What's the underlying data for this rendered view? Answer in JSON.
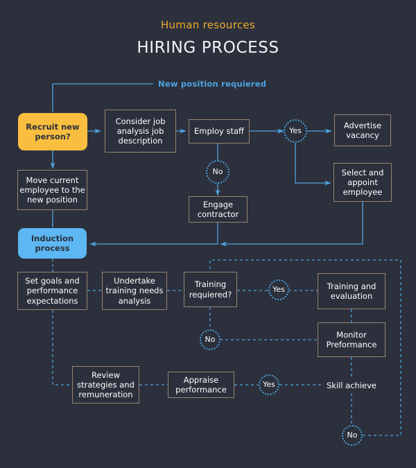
{
  "header": {
    "subtitle": "Human resources",
    "title": "HIRING PROCESS"
  },
  "colors": {
    "background": "#2b303c",
    "accent_yellow": "#f9be3f",
    "accent_blue": "#5db7f2",
    "line_blue": "#4fa3e0",
    "box_border": "#9b8470",
    "text": "#ffffff",
    "subtitle": "#f0ab2a"
  },
  "edge_labels": [
    {
      "id": "new-position",
      "text": "New position requiered"
    }
  ],
  "nodes": [
    {
      "id": "recruit-new-person",
      "label": "Recruit new person?",
      "shape": "rounded-yellow"
    },
    {
      "id": "consider-job-analysis",
      "label": "Consider job analysis job description",
      "shape": "rect"
    },
    {
      "id": "employ-staff",
      "label": "Employ staff",
      "shape": "rect"
    },
    {
      "id": "decision-yes-employ",
      "label": "Yes",
      "shape": "circle"
    },
    {
      "id": "advertise-vacancy",
      "label": "Advertise vacancy",
      "shape": "rect"
    },
    {
      "id": "decision-no-employ",
      "label": "No",
      "shape": "circle"
    },
    {
      "id": "engage-contractor",
      "label": "Engage contractor",
      "shape": "rect"
    },
    {
      "id": "select-appoint",
      "label": "Select and appoint employee",
      "shape": "rect"
    },
    {
      "id": "move-current-employee",
      "label": "Move current employee to the new position",
      "shape": "rect"
    },
    {
      "id": "induction-process",
      "label": "Induction process",
      "shape": "rounded-blue"
    },
    {
      "id": "set-goals",
      "label": "Set goals and performance expectations",
      "shape": "rect"
    },
    {
      "id": "undertake-training",
      "label": "Undertake training needs analysis",
      "shape": "rect"
    },
    {
      "id": "training-required",
      "label": "Training requiered?",
      "shape": "rect"
    },
    {
      "id": "decision-yes-training",
      "label": "Yes",
      "shape": "circle"
    },
    {
      "id": "training-evaluation",
      "label": "Training and evaluation",
      "shape": "rect"
    },
    {
      "id": "decision-no-training",
      "label": "No",
      "shape": "circle"
    },
    {
      "id": "monitor-performance",
      "label": "Monitor Preformance",
      "shape": "rect"
    },
    {
      "id": "review-strategies",
      "label": "Review strategies and remuneration",
      "shape": "rect"
    },
    {
      "id": "appraise-performance",
      "label": "Appraise performance",
      "shape": "rect"
    },
    {
      "id": "decision-yes-appraise",
      "label": "Yes",
      "shape": "circle"
    },
    {
      "id": "skill-achieve",
      "label": "Skill achieve",
      "shape": "plain"
    },
    {
      "id": "decision-no-skill",
      "label": "No",
      "shape": "circle"
    }
  ]
}
